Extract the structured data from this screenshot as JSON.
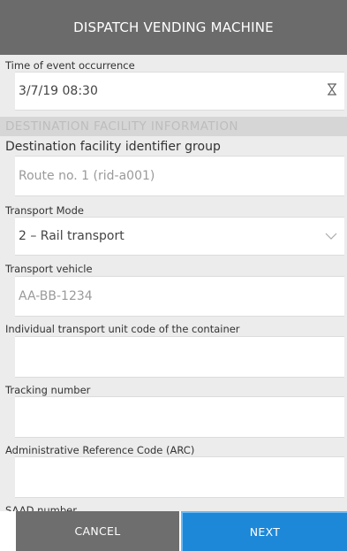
{
  "header": {
    "title": "DISPATCH VENDING MACHINE"
  },
  "form": {
    "event_time": {
      "label": "Time of event occurrence",
      "value": "3/7/19 08:30"
    },
    "section_title": "DESTINATION FACILITY INFORMATION",
    "destination_group": {
      "label": "Destination facility identifier group",
      "value": "Route no. 1 (rid-a001)"
    },
    "transport_mode": {
      "label": "Transport Mode",
      "value": "2 – Rail transport"
    },
    "transport_vehicle": {
      "label": "Transport vehicle",
      "value": "AA-BB-1234"
    },
    "unit_code": {
      "label": "Individual transport unit code of the container",
      "value": ""
    },
    "tracking": {
      "label": "Tracking number",
      "value": ""
    },
    "arc": {
      "label": "Administrative Reference Code (ARC)",
      "value": ""
    },
    "partial_label": "SAAD number"
  },
  "footer": {
    "cancel": "CANCEL",
    "next": "NEXT"
  },
  "icons": {
    "time": "hourglass-icon",
    "dropdown": "chevron-down-icon"
  }
}
